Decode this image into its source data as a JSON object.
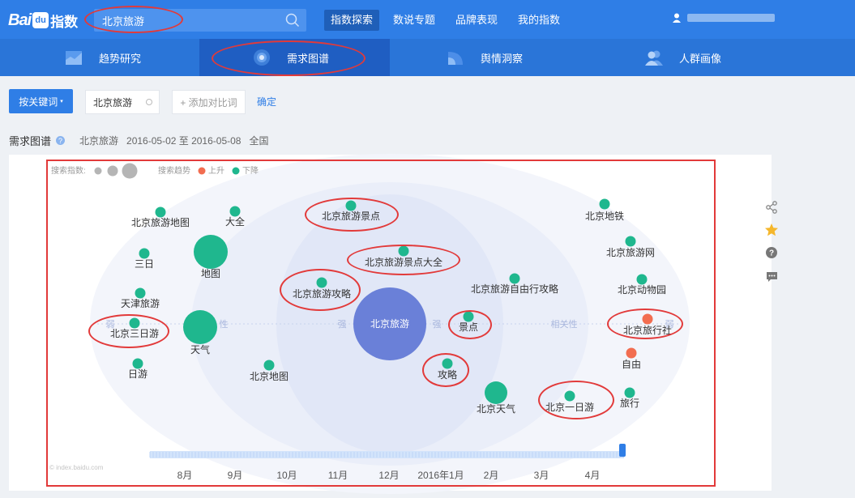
{
  "brand": {
    "bai": "Bai",
    "du": "du",
    "index": "指数"
  },
  "search": {
    "value": "北京旅游"
  },
  "topnav": [
    {
      "label": "指数探索",
      "active": true
    },
    {
      "label": "数说专题",
      "active": false
    },
    {
      "label": "品牌表现",
      "active": false
    },
    {
      "label": "我的指数",
      "active": false
    }
  ],
  "subnav": [
    {
      "label": "趋势研究",
      "active": false
    },
    {
      "label": "需求图谱",
      "active": true
    },
    {
      "label": "舆情洞察",
      "active": false
    },
    {
      "label": "人群画像",
      "active": false
    }
  ],
  "toolbar": {
    "keyword_button": "按关键词",
    "keyword_chip": "北京旅游",
    "add_compare": "+ 添加对比词",
    "confirm": "确定"
  },
  "info": {
    "title": "需求图谱",
    "keyword": "北京旅游",
    "date_range": "2016-05-02 至 2016-05-08",
    "region": "全国"
  },
  "legend": {
    "search_index_label": "搜索指数:",
    "trend_label": "搜索趋势",
    "rising": "上升",
    "falling": "下降",
    "rising_color": "#f26d50",
    "falling_color": "#1fb78e"
  },
  "axis_labels": {
    "weak": "弱",
    "correlation_left": "性",
    "strong_left": "强",
    "strong_right": "强",
    "correlation_right": "相关性",
    "weak_right": "弱"
  },
  "center": {
    "label": "北京旅游",
    "color": "#6a80d8"
  },
  "nodes": [
    {
      "label": "北京旅游地图",
      "trend": "down",
      "size": "s"
    },
    {
      "label": "大全",
      "trend": "down",
      "size": "s"
    },
    {
      "label": "三日",
      "trend": "down",
      "size": "s"
    },
    {
      "label": "地图",
      "trend": "down",
      "size": "l"
    },
    {
      "label": "天津旅游",
      "trend": "down",
      "size": "s"
    },
    {
      "label": "北京三日游",
      "trend": "down",
      "size": "s"
    },
    {
      "label": "天气",
      "trend": "down",
      "size": "l"
    },
    {
      "label": "日游",
      "trend": "down",
      "size": "s"
    },
    {
      "label": "北京地图",
      "trend": "down",
      "size": "s"
    },
    {
      "label": "北京旅游景点",
      "trend": "down",
      "size": "s"
    },
    {
      "label": "北京旅游景点大全",
      "trend": "down",
      "size": "s"
    },
    {
      "label": "北京旅游攻略",
      "trend": "down",
      "size": "s"
    },
    {
      "label": "北京旅游自由行攻略",
      "trend": "down",
      "size": "s"
    },
    {
      "label": "景点",
      "trend": "down",
      "size": "s"
    },
    {
      "label": "攻略",
      "trend": "down",
      "size": "s"
    },
    {
      "label": "北京天气",
      "trend": "down",
      "size": "m"
    },
    {
      "label": "北京一日游",
      "trend": "down",
      "size": "s"
    },
    {
      "label": "北京地铁",
      "trend": "down",
      "size": "s"
    },
    {
      "label": "北京旅游网",
      "trend": "down",
      "size": "s"
    },
    {
      "label": "北京动物园",
      "trend": "down",
      "size": "s"
    },
    {
      "label": "北京旅行社",
      "trend": "up",
      "size": "s"
    },
    {
      "label": "自由",
      "trend": "up",
      "size": "s"
    },
    {
      "label": "旅行",
      "trend": "down",
      "size": "s"
    }
  ],
  "timeline": {
    "months": [
      "8月",
      "9月",
      "10月",
      "11月",
      "12月",
      "2016年1月",
      "2月",
      "3月",
      "4月"
    ],
    "position": 1.0
  },
  "watermark": "© index.baidu.com",
  "icons": [
    "search-icon",
    "user-icon",
    "share-icon",
    "star-icon",
    "question-icon",
    "comment-icon"
  ]
}
